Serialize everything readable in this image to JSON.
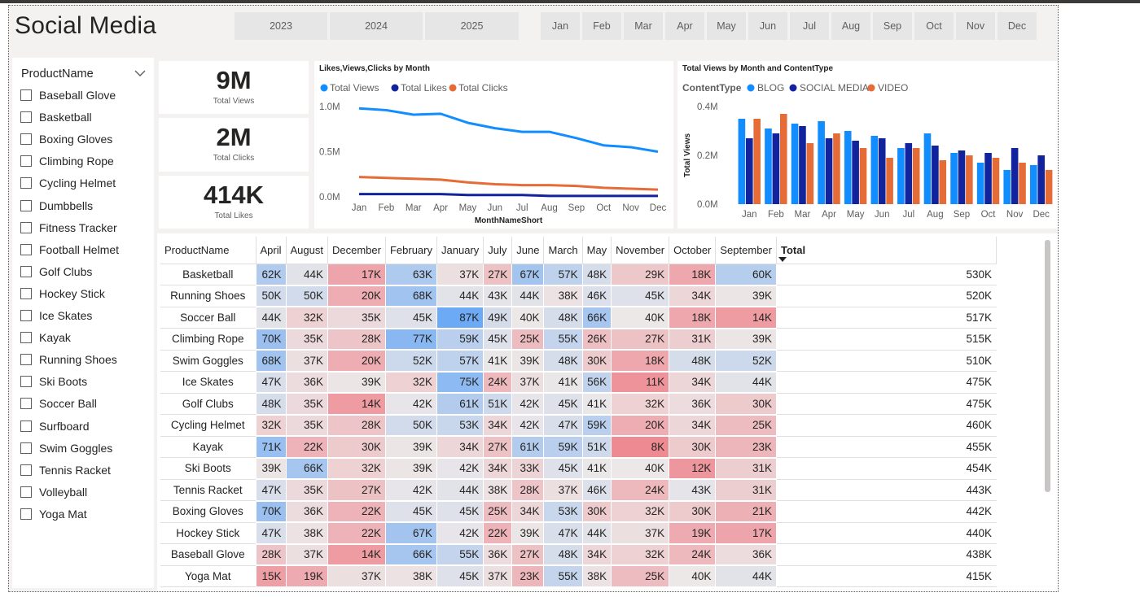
{
  "title": "Social Media",
  "years": [
    "2023",
    "2024",
    "2025"
  ],
  "months": [
    "Jan",
    "Feb",
    "Mar",
    "Apr",
    "May",
    "Jun",
    "Jul",
    "Aug",
    "Sep",
    "Oct",
    "Nov",
    "Dec"
  ],
  "slicer": {
    "header": "ProductName",
    "items": [
      "Baseball Glove",
      "Basketball",
      "Boxing Gloves",
      "Climbing Rope",
      "Cycling Helmet",
      "Dumbbells",
      "Fitness Tracker",
      "Football Helmet",
      "Golf Clubs",
      "Hockey Stick",
      "Ice Skates",
      "Kayak",
      "Running Shoes",
      "Ski Boots",
      "Soccer Ball",
      "Surfboard",
      "Swim Goggles",
      "Tennis Racket",
      "Volleyball",
      "Yoga Mat"
    ]
  },
  "cards": [
    {
      "value": "9M",
      "label": "Total Views"
    },
    {
      "value": "2M",
      "label": "Total Clicks"
    },
    {
      "value": "414K",
      "label": "Total Likes"
    }
  ],
  "colors": {
    "views": "#118DFF",
    "likes": "#12239E",
    "clicks": "#E66C37",
    "blue_cell": "#6DAAF5",
    "red_cell": "#EE8A92"
  },
  "chart_data": [
    {
      "type": "line",
      "title": "Likes,Views,Clicks by Month",
      "xlabel": "MonthNameShort",
      "ylabel": "",
      "categories": [
        "Jan",
        "Feb",
        "Mar",
        "Apr",
        "May",
        "Jun",
        "Jul",
        "Aug",
        "Sep",
        "Oct",
        "Nov",
        "Dec"
      ],
      "y_ticks": [
        "0.0M",
        "0.5M",
        "1.0M"
      ],
      "ylim": [
        0,
        1.0
      ],
      "legend_position": "top-left",
      "series": [
        {
          "name": "Total Views",
          "color": "#118DFF",
          "values": [
            0.98,
            0.96,
            0.91,
            0.92,
            0.82,
            0.76,
            0.72,
            0.72,
            0.65,
            0.57,
            0.55,
            0.5
          ]
        },
        {
          "name": "Total Likes",
          "color": "#12239E",
          "values": [
            0.03,
            0.03,
            0.03,
            0.03,
            0.02,
            0.02,
            0.02,
            0.01,
            0.01,
            0.01,
            0.01,
            0.01
          ]
        },
        {
          "name": "Total Clicks",
          "color": "#E66C37",
          "values": [
            0.22,
            0.21,
            0.2,
            0.19,
            0.16,
            0.14,
            0.13,
            0.13,
            0.12,
            0.1,
            0.09,
            0.08
          ]
        }
      ]
    },
    {
      "type": "bar",
      "title": "Total Views by Month and ContentType",
      "xlabel": "",
      "ylabel": "Total Views",
      "legend_title": "ContentType",
      "legend_position": "top-left",
      "categories": [
        "Jan",
        "Feb",
        "Mar",
        "Apr",
        "May",
        "Jun",
        "Jul",
        "Aug",
        "Sep",
        "Oct",
        "Nov",
        "Dec"
      ],
      "y_ticks": [
        "0.0M",
        "0.2M",
        "0.4M"
      ],
      "ylim": [
        0,
        0.4
      ],
      "series": [
        {
          "name": "BLOG",
          "color": "#118DFF",
          "values": [
            0.35,
            0.31,
            0.33,
            0.34,
            0.3,
            0.28,
            0.23,
            0.29,
            0.21,
            0.17,
            0.14,
            0.16
          ]
        },
        {
          "name": "SOCIAL MEDIA",
          "color": "#12239E",
          "values": [
            0.27,
            0.29,
            0.32,
            0.27,
            0.26,
            0.27,
            0.25,
            0.24,
            0.22,
            0.21,
            0.23,
            0.2
          ]
        },
        {
          "name": "VIDEO",
          "color": "#E66C37",
          "values": [
            0.35,
            0.37,
            0.25,
            0.29,
            0.23,
            0.19,
            0.23,
            0.18,
            0.2,
            0.19,
            0.17,
            0.14
          ]
        }
      ]
    }
  ],
  "matrix": {
    "row_header": "ProductName",
    "columns": [
      "April",
      "August",
      "December",
      "February",
      "January",
      "July",
      "June",
      "March",
      "May",
      "November",
      "October",
      "September"
    ],
    "total_header": "Total",
    "rows": [
      {
        "name": "Basketball",
        "values": [
          62,
          44,
          17,
          63,
          37,
          27,
          67,
          57,
          48,
          29,
          18,
          60
        ],
        "total": "530K"
      },
      {
        "name": "Running Shoes",
        "values": [
          50,
          50,
          20,
          68,
          44,
          43,
          44,
          38,
          46,
          45,
          34,
          39
        ],
        "total": "520K"
      },
      {
        "name": "Soccer Ball",
        "values": [
          44,
          32,
          35,
          45,
          87,
          49,
          40,
          48,
          66,
          40,
          18,
          14
        ],
        "total": "517K"
      },
      {
        "name": "Climbing Rope",
        "values": [
          70,
          35,
          28,
          77,
          59,
          45,
          25,
          55,
          26,
          27,
          31,
          39
        ],
        "total": "515K"
      },
      {
        "name": "Swim Goggles",
        "values": [
          68,
          37,
          20,
          52,
          57,
          41,
          39,
          48,
          30,
          18,
          48,
          52
        ],
        "total": "510K"
      },
      {
        "name": "Ice Skates",
        "values": [
          47,
          36,
          39,
          32,
          75,
          24,
          37,
          41,
          56,
          11,
          34,
          44
        ],
        "total": "475K"
      },
      {
        "name": "Golf Clubs",
        "values": [
          48,
          35,
          14,
          42,
          61,
          51,
          42,
          45,
          41,
          32,
          36,
          30
        ],
        "total": "475K"
      },
      {
        "name": "Cycling Helmet",
        "values": [
          32,
          35,
          28,
          50,
          53,
          34,
          42,
          47,
          59,
          20,
          34,
          25
        ],
        "total": "460K"
      },
      {
        "name": "Kayak",
        "values": [
          71,
          22,
          30,
          39,
          34,
          27,
          61,
          59,
          51,
          8,
          30,
          23
        ],
        "total": "455K"
      },
      {
        "name": "Ski Boots",
        "values": [
          39,
          66,
          32,
          39,
          42,
          34,
          33,
          45,
          41,
          40,
          12,
          31
        ],
        "total": "454K"
      },
      {
        "name": "Tennis Racket",
        "values": [
          47,
          35,
          27,
          42,
          44,
          38,
          28,
          37,
          46,
          24,
          43,
          31
        ],
        "total": "443K"
      },
      {
        "name": "Boxing Gloves",
        "values": [
          70,
          36,
          22,
          45,
          45,
          25,
          34,
          53,
          30,
          32,
          30,
          21
        ],
        "total": "442K"
      },
      {
        "name": "Hockey Stick",
        "values": [
          47,
          38,
          22,
          67,
          42,
          22,
          39,
          47,
          44,
          37,
          19,
          17
        ],
        "total": "440K"
      },
      {
        "name": "Baseball Glove",
        "values": [
          28,
          37,
          14,
          66,
          55,
          36,
          27,
          48,
          34,
          32,
          24,
          36
        ],
        "total": "438K"
      },
      {
        "name": "Yoga Mat",
        "values": [
          15,
          19,
          37,
          38,
          45,
          37,
          23,
          55,
          38,
          25,
          40,
          44
        ],
        "total": "415K"
      }
    ]
  }
}
